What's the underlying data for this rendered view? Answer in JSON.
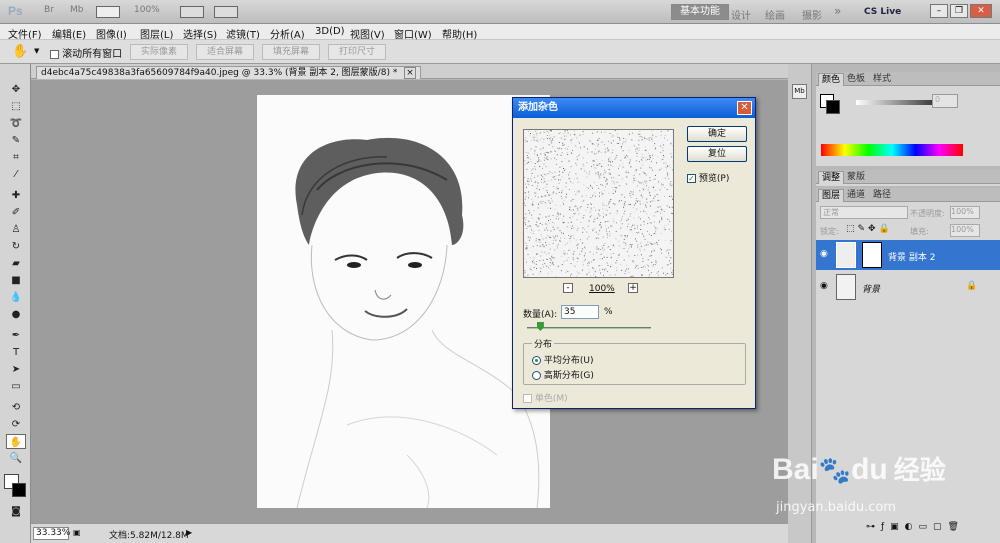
{
  "app": {
    "logo": "Ps",
    "appbar_icons": [
      "Br",
      "Mb"
    ],
    "zoom_select": "100%",
    "workspace_active": "基本功能",
    "workspace_links": [
      "设计",
      "绘画",
      "摄影"
    ],
    "more": "»",
    "cs_live": "CS Live"
  },
  "menu": [
    "文件(F)",
    "编辑(E)",
    "图像(I)",
    "图层(L)",
    "选择(S)",
    "滤镜(T)",
    "分析(A)",
    "3D(D)",
    "视图(V)",
    "窗口(W)",
    "帮助(H)"
  ],
  "options": {
    "scroll_all_label": "滚动所有窗口",
    "buttons": [
      "实际像素",
      "适合屏幕",
      "填充屏幕",
      "打印尺寸"
    ]
  },
  "document": {
    "tab_title": "d4ebc4a75c49838a3fa65609784f9a40.jpeg @ 33.3% (背景 副本 2, 图层蒙版/8) *",
    "tab_close": "×"
  },
  "status": {
    "zoom": "33.33%",
    "doc_info": "文档:5.82M/12.8M"
  },
  "dialog": {
    "title": "添加杂色",
    "close": "✕",
    "ok": "确定",
    "reset": "复位",
    "preview_label": "预览(P)",
    "preview_checked": true,
    "zoom_minus": "-",
    "zoom_value": "100%",
    "zoom_plus": "+",
    "amount_label": "数量(A):",
    "amount_value": "35",
    "amount_unit": "%",
    "amount_slider_percent": 8,
    "distribution_label": "分布",
    "uniform_label": "平均分布(U)",
    "gaussian_label": "高斯分布(G)",
    "selected_distribution": "uniform",
    "monochromatic_label": "单色(M)",
    "monochromatic_checked": false
  },
  "panels": {
    "color_tabs": [
      "颜色",
      "色板",
      "样式"
    ],
    "adjust_tabs": [
      "调整",
      "蒙版"
    ],
    "layer_tabs": [
      "图层",
      "通道",
      "路径"
    ],
    "blend_mode": "正常",
    "opacity_label": "不透明度:",
    "opacity_value": "100%",
    "lock_label": "锁定:",
    "fill_label": "填充:",
    "fill_value": "100%",
    "color_value": "0",
    "layers": [
      {
        "name": "背景 副本 2",
        "selected": true
      },
      {
        "name": "背景",
        "selected": false
      }
    ]
  },
  "watermark": {
    "brand": "Bai",
    "brand2": "du",
    "cn": "经验",
    "url": "jingyan.baidu.com"
  },
  "colors": {
    "dialog_title": "#0a5fd6",
    "selected_layer": "#3375cf",
    "canvas_bg": "#9d9d9d"
  }
}
